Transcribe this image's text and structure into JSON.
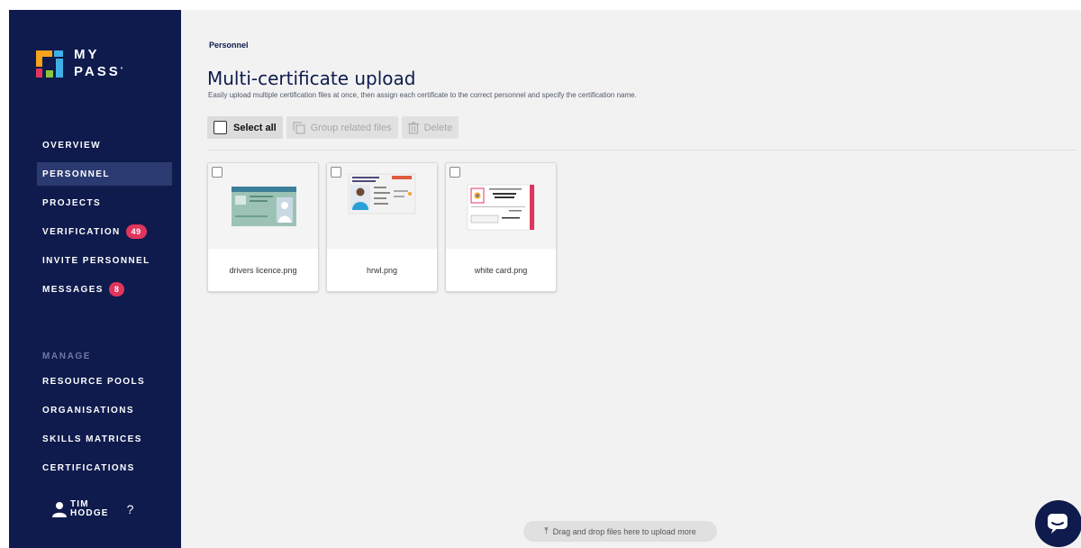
{
  "brand": {
    "line1": "MY",
    "line2": "PASS",
    "mark_colors": [
      "#f7a21b",
      "#3fb0e6",
      "#e0355d",
      "#8ac53f"
    ]
  },
  "nav": {
    "items": [
      {
        "label": "OVERVIEW"
      },
      {
        "label": "PERSONNEL",
        "active": true
      },
      {
        "label": "PROJECTS"
      },
      {
        "label": "VERIFICATION",
        "badge": "49"
      },
      {
        "label": "INVITE PERSONNEL"
      },
      {
        "label": "MESSAGES",
        "badge": "8"
      }
    ],
    "section_label": "MANAGE",
    "manage_items": [
      {
        "label": "RESOURCE POOLS"
      },
      {
        "label": "ORGANISATIONS"
      },
      {
        "label": "SKILLS MATRICES"
      },
      {
        "label": "CERTIFICATIONS"
      }
    ]
  },
  "user": {
    "first": "TIM",
    "last": "HODGE",
    "help": "?"
  },
  "page": {
    "breadcrumb": "Personnel",
    "title": "Multi-certificate upload",
    "subtitle": "Easily upload multiple certification files at once, then assign each certificate to the correct personnel and specify the certification name."
  },
  "toolbar": {
    "select_all": "Select all",
    "group": "Group related files",
    "delete": "Delete"
  },
  "files": [
    {
      "name": "drivers licence.png"
    },
    {
      "name": "hrwl.png"
    },
    {
      "name": "white card.png"
    }
  ],
  "dropzone": {
    "label": "Drag and drop files here to upload more",
    "icon": "upload-icon"
  },
  "colors": {
    "sidebar": "#0f1b4d",
    "badge": "#e0355d",
    "main_bg": "#f2f2f2"
  }
}
